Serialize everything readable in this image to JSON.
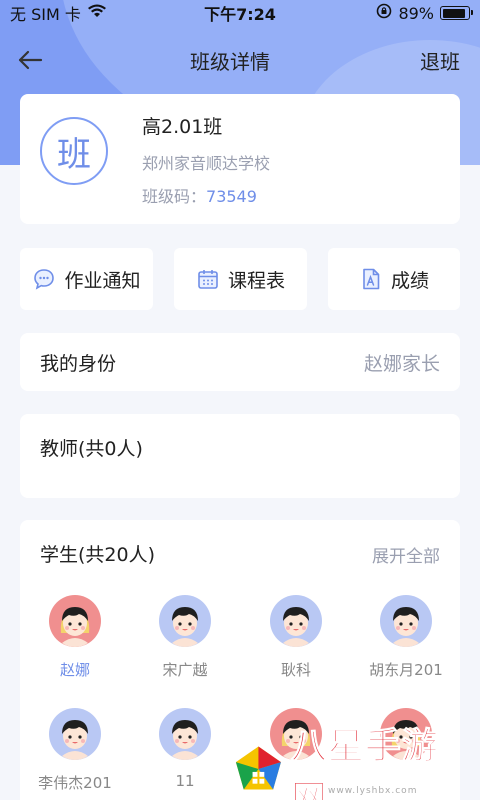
{
  "status_bar": {
    "carrier": "无 SIM 卡",
    "time": "下午7:24",
    "battery_text": "89%",
    "battery_level": 0.89
  },
  "nav": {
    "title": "班级详情",
    "right_action": "退班"
  },
  "class_info": {
    "avatar_char": "班",
    "name": "高2.01班",
    "school": "郑州家音顺达学校",
    "code_label": "班级码：",
    "code_value": "73549"
  },
  "quick_actions": [
    {
      "label": "作业通知",
      "icon": "chat-bubble-icon"
    },
    {
      "label": "课程表",
      "icon": "calendar-icon"
    },
    {
      "label": "成绩",
      "icon": "document-a-icon"
    }
  ],
  "identity": {
    "label": "我的身份",
    "value": "赵娜家长"
  },
  "teachers": {
    "label": "教师(共0人)"
  },
  "students": {
    "label": "学生(共20人)",
    "expand_label": "展开全部",
    "items": [
      {
        "name": "赵娜",
        "gender": "girl",
        "active": true
      },
      {
        "name": "宋广越",
        "gender": "boy",
        "active": false
      },
      {
        "name": "耿科",
        "gender": "boy",
        "active": false
      },
      {
        "name": "胡东月201",
        "gender": "boy",
        "active": false
      },
      {
        "name": "李伟杰201",
        "gender": "boy",
        "active": false
      },
      {
        "name": "11",
        "gender": "boy",
        "active": false
      },
      {
        "name": "",
        "gender": "girl",
        "active": false
      },
      {
        "name": "",
        "gender": "girl",
        "active": false
      }
    ]
  },
  "watermark": {
    "text": "八星手游网",
    "url": "www.lyshbx.com"
  },
  "colors": {
    "accent": "#6f8ee8",
    "header_bg": "#7f9df4",
    "page_bg": "#f4f6fb",
    "muted_text": "#9a9fb0"
  }
}
